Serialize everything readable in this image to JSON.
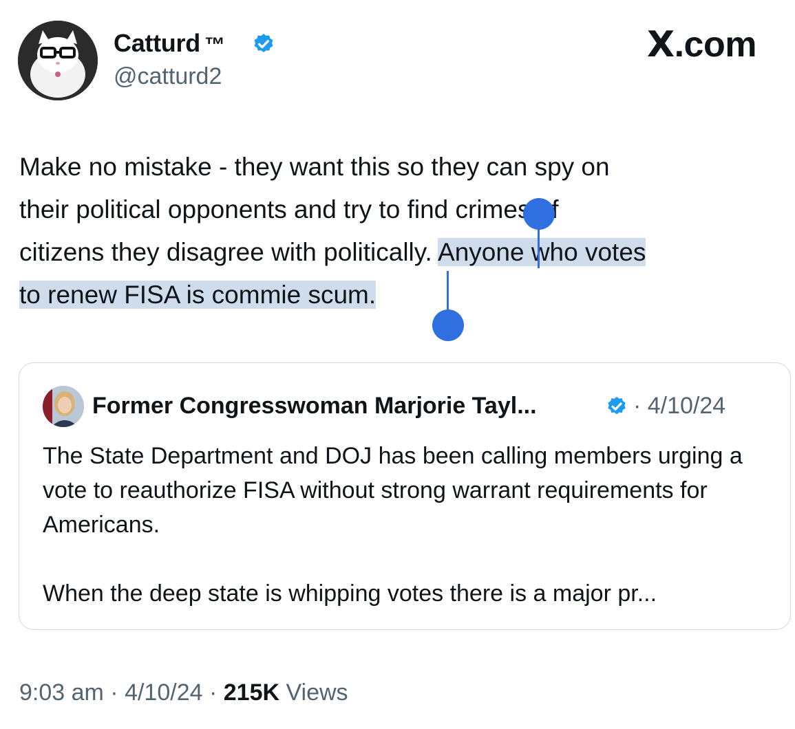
{
  "author": {
    "name": "Catturd",
    "tm": "™",
    "handle": "@catturd2",
    "verified": true
  },
  "brand": {
    "text": ".com",
    "logo": "X"
  },
  "tweet": {
    "lines": [
      {
        "plain": "Make no mistake - they want this so they can spy on",
        "selected": ""
      },
      {
        "plain": "their political opponents and try to find crimes of",
        "selected": ""
      },
      {
        "plain": "citizens they disagree with politically. ",
        "selected": "Anyone who votes"
      },
      {
        "plain": "",
        "selected": "to renew FISA is commie scum."
      }
    ]
  },
  "quote": {
    "name": "Former Congresswoman Marjorie Tayl...",
    "date": "· 4/10/24",
    "verified": true,
    "paragraphs": [
      "The State Department and DOJ has been calling members urging a vote to reauthorize FISA without strong warrant requirements for Americans.",
      "When the deep state is whipping votes there is a major pr..."
    ]
  },
  "footer": {
    "time": "9:03 am",
    "sep1": " · ",
    "date": "4/10/24",
    "sep2": " · ",
    "views_count": "215K",
    "views_label": " Views"
  },
  "colors": {
    "selection": "#cfdcec",
    "handle": "#2f6fe0",
    "verified": "#1d9bf0",
    "muted": "#536471"
  }
}
